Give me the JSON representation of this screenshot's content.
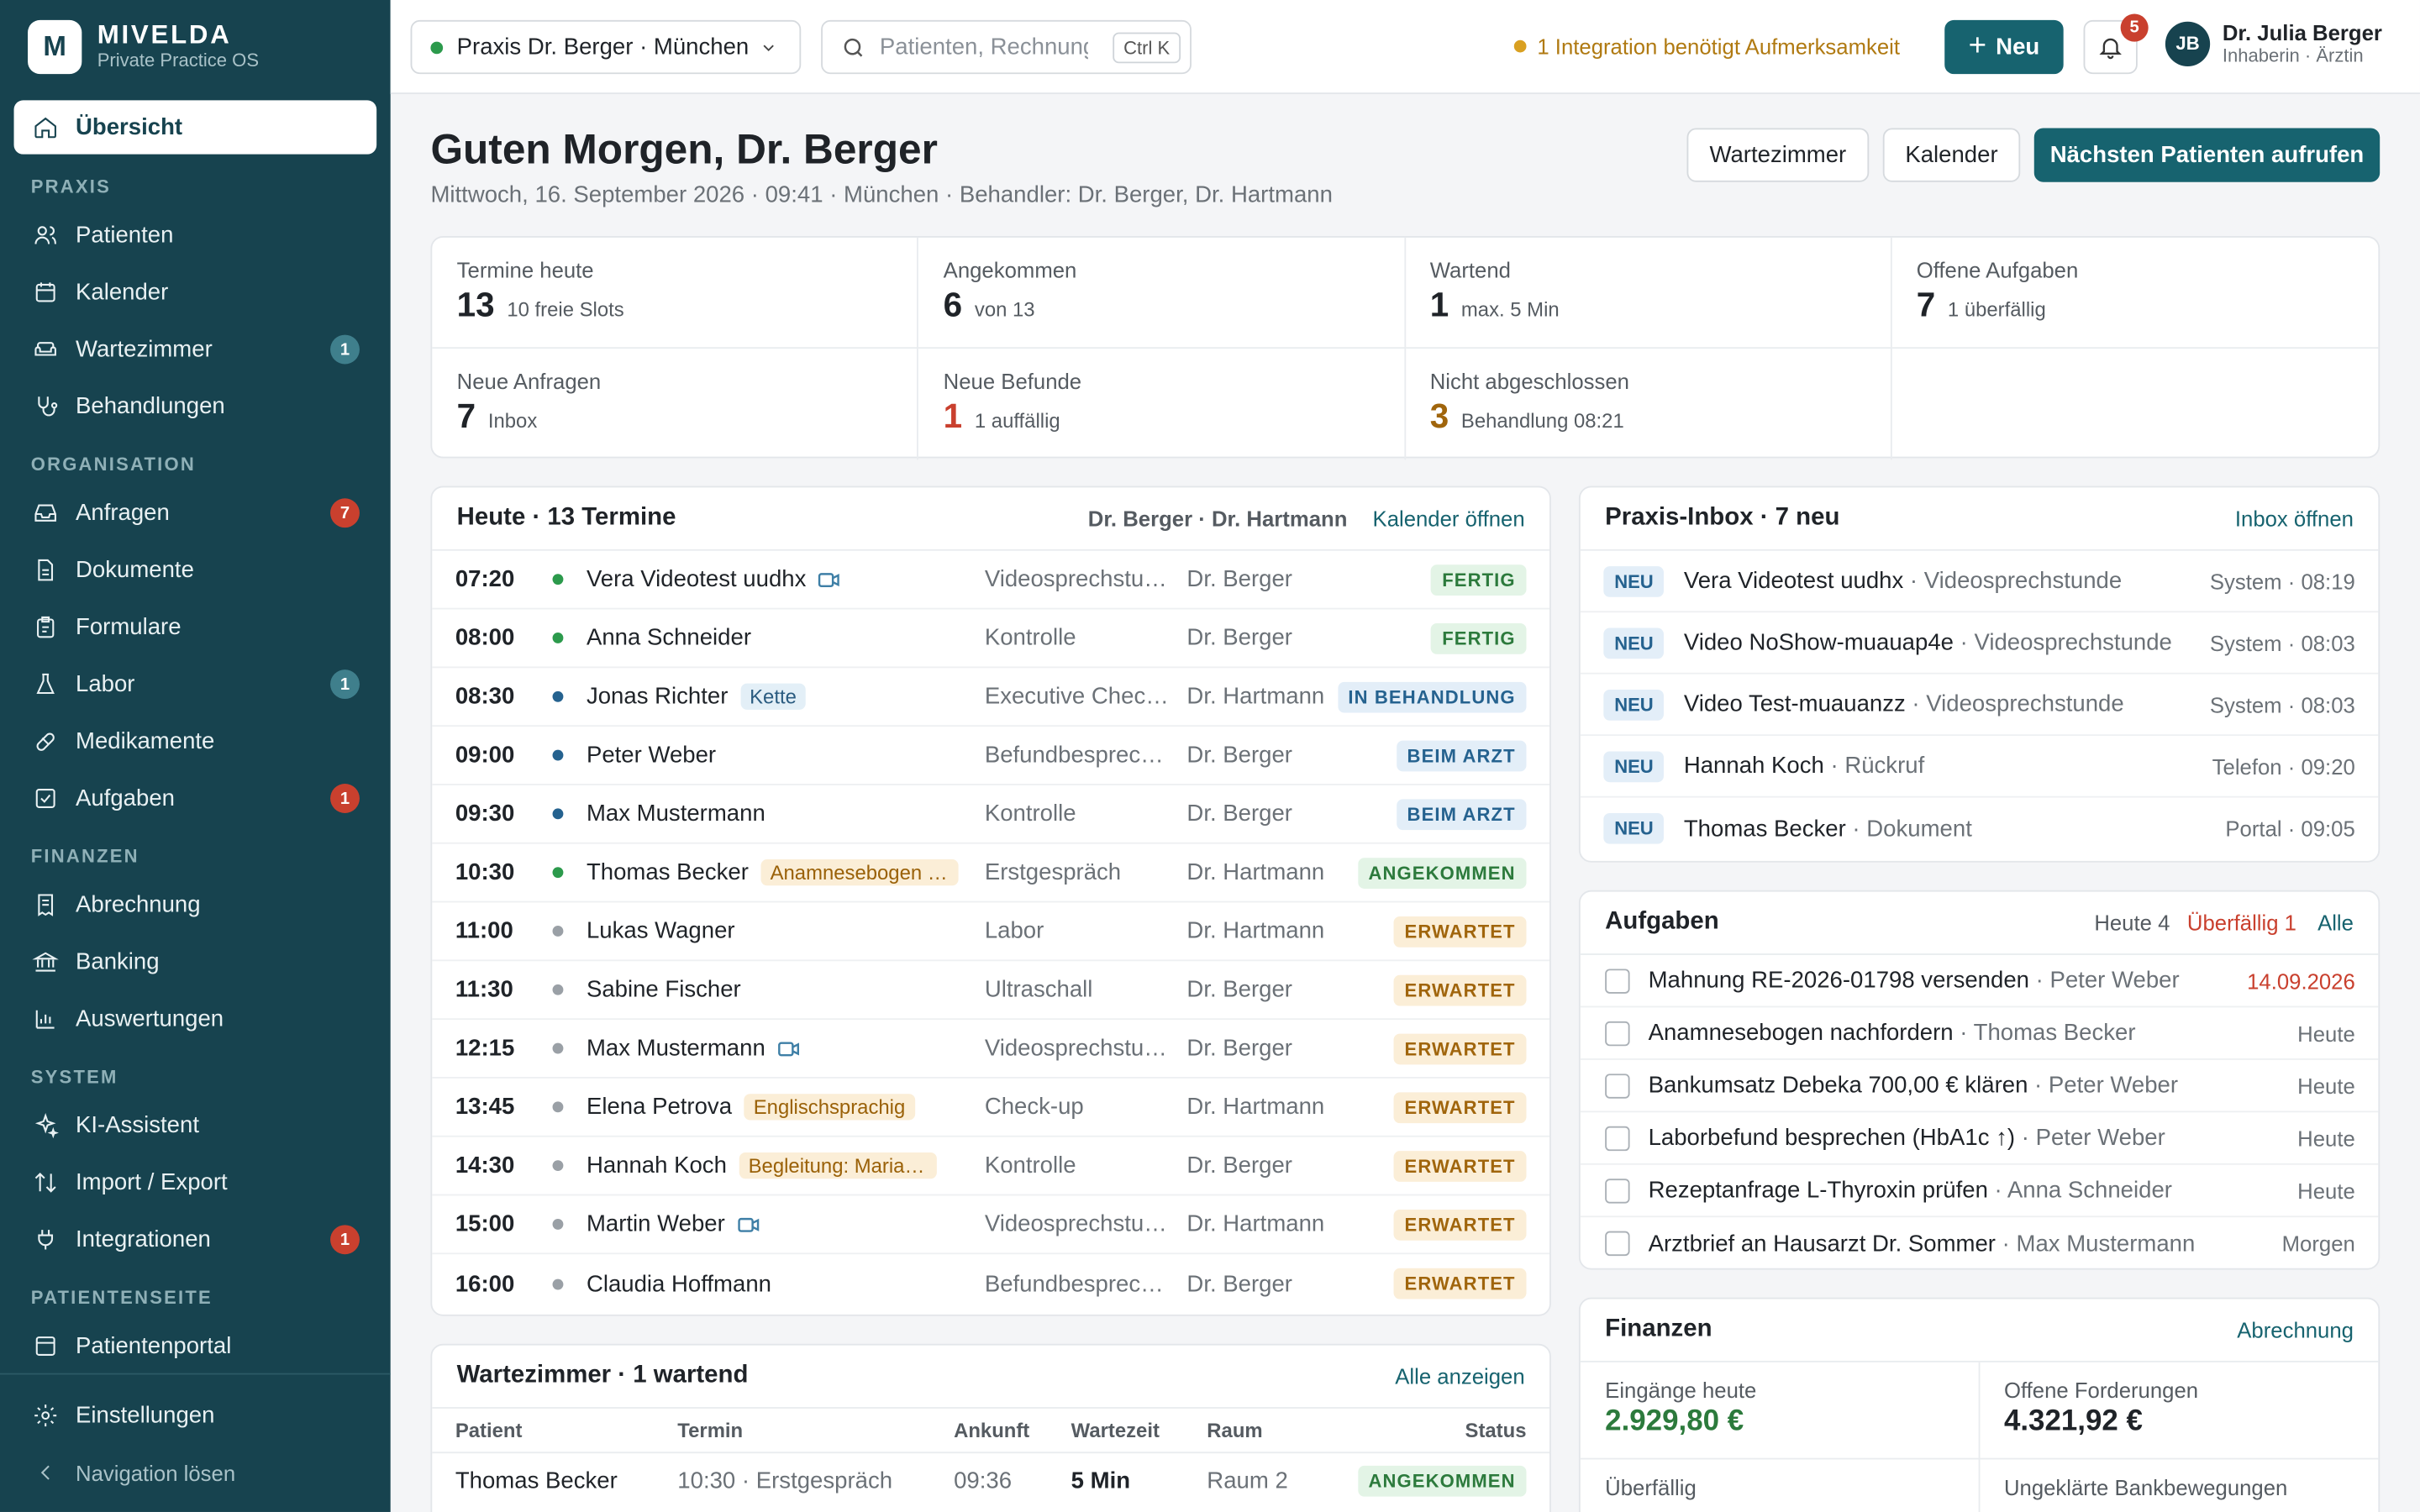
{
  "brand": {
    "logo": "M",
    "name": "MIVELDA",
    "tagline": "Private Practice OS"
  },
  "colors": {
    "primary": "#17636f",
    "sidebar": "#17434f",
    "success": "#2c7a3c",
    "danger": "#c9402e",
    "warning": "#a0650c"
  },
  "sidebar": {
    "active": {
      "label": "Übersicht",
      "icon": "home-icon"
    },
    "sections": [
      {
        "title": "PRAXIS",
        "items": [
          {
            "label": "Patienten",
            "icon": "users-icon",
            "badge": ""
          },
          {
            "label": "Kalender",
            "icon": "calendar-icon",
            "badge": ""
          },
          {
            "label": "Wartezimmer",
            "icon": "sofa-icon",
            "badge": "1"
          },
          {
            "label": "Behandlungen",
            "icon": "stethoscope-icon",
            "badge": ""
          }
        ]
      },
      {
        "title": "ORGANISATION",
        "items": [
          {
            "label": "Anfragen",
            "icon": "inbox-icon",
            "badge": "7"
          },
          {
            "label": "Dokumente",
            "icon": "document-icon",
            "badge": ""
          },
          {
            "label": "Formulare",
            "icon": "clipboard-icon",
            "badge": ""
          },
          {
            "label": "Labor",
            "icon": "flask-icon",
            "badge": "1"
          },
          {
            "label": "Medikamente",
            "icon": "pill-icon",
            "badge": ""
          },
          {
            "label": "Aufgaben",
            "icon": "check-square-icon",
            "badge": "1"
          }
        ]
      },
      {
        "title": "FINANZEN",
        "items": [
          {
            "label": "Abrechnung",
            "icon": "receipt-icon",
            "badge": ""
          },
          {
            "label": "Banking",
            "icon": "bank-icon",
            "badge": ""
          },
          {
            "label": "Auswertungen",
            "icon": "bar-chart-icon",
            "badge": ""
          }
        ]
      },
      {
        "title": "SYSTEM",
        "items": [
          {
            "label": "KI-Assistent",
            "icon": "sparkles-icon",
            "badge": ""
          },
          {
            "label": "Import / Export",
            "icon": "arrows-icon",
            "badge": ""
          },
          {
            "label": "Integrationen",
            "icon": "plug-icon",
            "badge": "1"
          }
        ]
      },
      {
        "title": "PATIENTENSEITE",
        "items": [
          {
            "label": "Patientenportal",
            "icon": "portal-icon",
            "badge": ""
          }
        ]
      }
    ],
    "settings": "Einstellungen",
    "collapse": "Navigation lösen"
  },
  "topbar": {
    "practice": "Praxis Dr. Berger · München",
    "search_placeholder": "Patienten, Rechnungen …",
    "search_shortcut": "Ctrl K",
    "integration_alert": "1 Integration benötigt Aufmerksamkeit",
    "new_label": "Neu",
    "notifications": "5",
    "user": {
      "initials": "JB",
      "name": "Dr. Julia Berger",
      "role": "Inhaberin · Ärztin"
    }
  },
  "header": {
    "greeting": "Guten Morgen, Dr. Berger",
    "subtitle": "Mittwoch, 16. September 2026 · 09:41 · München · Behandler: Dr. Berger, Dr. Hartmann",
    "btn_waiting": "Wartezimmer",
    "btn_calendar": "Kalender",
    "btn_next": "Nächsten Patienten aufrufen"
  },
  "stats": [
    {
      "label": "Termine heute",
      "value": "13",
      "sub": "10 freie Slots",
      "color": "#1f2328"
    },
    {
      "label": "Angekommen",
      "value": "6",
      "sub": "von 13",
      "color": "#1f2328"
    },
    {
      "label": "Wartend",
      "value": "1",
      "sub": "max. 5 Min",
      "color": "#1f2328"
    },
    {
      "label": "Offene Aufgaben",
      "value": "7",
      "sub": "1 überfällig",
      "color": "#1f2328"
    },
    {
      "label": "Neue Anfragen",
      "value": "7",
      "sub": "Inbox",
      "color": "#1f2328"
    },
    {
      "label": "Neue Befunde",
      "value": "1",
      "sub": "1 auffällig",
      "color": "#c9402e"
    },
    {
      "label": "Nicht abgeschlossen",
      "value": "3",
      "sub": "Behandlung 08:21",
      "color": "#a0650c"
    }
  ],
  "today": {
    "title": "Heute · 13 Termine",
    "doctors": "Dr. Berger · Dr. Hartmann",
    "link": "Kalender öffnen",
    "rows": [
      {
        "time": "07:20",
        "dot": "#2c9a4c",
        "name": "Vera Videotest uudhx",
        "video": true,
        "tag": "",
        "tagType": "",
        "type": "Videosprechstunde",
        "doctor": "Dr. Berger",
        "status": "FERTIG",
        "st": "st-fertig"
      },
      {
        "time": "08:00",
        "dot": "#2c9a4c",
        "name": "Anna Schneider",
        "video": false,
        "tag": "",
        "tagType": "",
        "type": "Kontrolle",
        "doctor": "Dr. Berger",
        "status": "FERTIG",
        "st": "st-fertig"
      },
      {
        "time": "08:30",
        "dot": "#25628f",
        "name": "Jonas Richter",
        "video": false,
        "tag": "Kette",
        "tagType": "tag-blue",
        "type": "Executive Check-up",
        "doctor": "Dr. Hartmann",
        "status": "IN BEHANDLUNG",
        "st": "st-behandlung"
      },
      {
        "time": "09:00",
        "dot": "#25628f",
        "name": "Peter Weber",
        "video": false,
        "tag": "",
        "tagType": "",
        "type": "Befundbesprechung",
        "doctor": "Dr. Berger",
        "status": "BEIM ARZT",
        "st": "st-arzt"
      },
      {
        "time": "09:30",
        "dot": "#25628f",
        "name": "Max Mustermann",
        "video": false,
        "tag": "",
        "tagType": "",
        "type": "Kontrolle",
        "doctor": "Dr. Berger",
        "status": "BEIM ARZT",
        "st": "st-arzt"
      },
      {
        "time": "10:30",
        "dot": "#2c9a4c",
        "name": "Thomas Becker",
        "video": false,
        "tag": "Anamnesebogen fehlt",
        "tagType": "tag-orange",
        "type": "Erstgespräch",
        "doctor": "Dr. Hartmann",
        "status": "ANGEKOMMEN",
        "st": "st-angekommen"
      },
      {
        "time": "11:00",
        "dot": "#9aa0a6",
        "name": "Lukas Wagner",
        "video": false,
        "tag": "",
        "tagType": "",
        "type": "Labor",
        "doctor": "Dr. Hartmann",
        "status": "ERWARTET",
        "st": "st-erwartet"
      },
      {
        "time": "11:30",
        "dot": "#9aa0a6",
        "name": "Sabine Fischer",
        "video": false,
        "tag": "",
        "tagType": "",
        "type": "Ultraschall",
        "doctor": "Dr. Berger",
        "status": "ERWARTET",
        "st": "st-erwartet"
      },
      {
        "time": "12:15",
        "dot": "#9aa0a6",
        "name": "Max Mustermann",
        "video": true,
        "tag": "",
        "tagType": "",
        "type": "Videosprechstunde",
        "doctor": "Dr. Berger",
        "status": "ERWARTET",
        "st": "st-erwartet"
      },
      {
        "time": "13:45",
        "dot": "#9aa0a6",
        "name": "Elena Petrova",
        "video": false,
        "tag": "Englischsprachig",
        "tagType": "tag-orange",
        "type": "Check-up",
        "doctor": "Dr. Hartmann",
        "status": "ERWARTET",
        "st": "st-erwartet"
      },
      {
        "time": "14:30",
        "dot": "#9aa0a6",
        "name": "Hannah Koch",
        "video": false,
        "tag": "Begleitung: Maria Koch",
        "tagType": "tag-orange",
        "type": "Kontrolle",
        "doctor": "Dr. Berger",
        "status": "ERWARTET",
        "st": "st-erwartet"
      },
      {
        "time": "15:00",
        "dot": "#9aa0a6",
        "name": "Martin Weber",
        "video": true,
        "tag": "",
        "tagType": "",
        "type": "Videosprechstunde",
        "doctor": "Dr. Hartmann",
        "status": "ERWARTET",
        "st": "st-erwartet"
      },
      {
        "time": "16:00",
        "dot": "#9aa0a6",
        "name": "Claudia Hoffmann",
        "video": false,
        "tag": "",
        "tagType": "",
        "type": "Befundbesprechung",
        "doctor": "Dr. Berger",
        "status": "ERWARTET",
        "st": "st-erwartet"
      }
    ]
  },
  "waiting": {
    "title": "Wartezimmer · 1 wartend",
    "link": "Alle anzeigen",
    "cols": [
      "Patient",
      "Termin",
      "Ankunft",
      "Wartezeit",
      "Raum",
      "Status"
    ],
    "rows": [
      {
        "patient": "Thomas Becker",
        "termin": "10:30 · Erstgespräch",
        "ankunft": "09:36",
        "wartezeit": "5 Min",
        "raum": "Raum 2",
        "status": "ANGEKOMMEN"
      }
    ]
  },
  "inbox": {
    "title": "Praxis-Inbox · 7 neu",
    "link": "Inbox öffnen",
    "badge": "NEU",
    "rows": [
      {
        "name": "Vera Videotest uudhx",
        "kind": "Videosprechstunde",
        "meta": "System · 08:19"
      },
      {
        "name": "Video NoShow-muauap4e",
        "kind": "Videosprechstunde",
        "meta": "System · 08:03"
      },
      {
        "name": "Video Test-muauanzz",
        "kind": "Videosprechstunde",
        "meta": "System · 08:03"
      },
      {
        "name": "Hannah Koch",
        "kind": "Rückruf",
        "meta": "Telefon · 09:20"
      },
      {
        "name": "Thomas Becker",
        "kind": "Dokument",
        "meta": "Portal · 09:05"
      }
    ]
  },
  "tasks": {
    "title": "Aufgaben",
    "today": "Heute 4",
    "overdue": "Überfällig 1",
    "all": "Alle",
    "rows": [
      {
        "text": "Mahnung RE-2026-01798 versenden",
        "who": "Peter Weber",
        "due": "14.09.2026",
        "overdue": true
      },
      {
        "text": "Anamnesebogen nachfordern",
        "who": "Thomas Becker",
        "due": "Heute",
        "overdue": false
      },
      {
        "text": "Bankumsatz Debeka 700,00 € klären",
        "who": "Peter Weber",
        "due": "Heute",
        "overdue": false
      },
      {
        "text": "Laborbefund besprechen (HbA1c ↑)",
        "who": "Peter Weber",
        "due": "Heute",
        "overdue": false
      },
      {
        "text": "Rezeptanfrage L-Thyroxin prüfen",
        "who": "Anna Schneider",
        "due": "Heute",
        "overdue": false
      },
      {
        "text": "Arztbrief an Hausarzt Dr. Sommer",
        "who": "Max Mustermann",
        "due": "Morgen",
        "overdue": false
      }
    ]
  },
  "finance": {
    "title": "Finanzen",
    "link": "Abrechnung",
    "cells": [
      {
        "label": "Eingänge heute",
        "value": "2.929,80 €",
        "color": "#2c7a3c"
      },
      {
        "label": "Offene Forderungen",
        "value": "4.321,92 €",
        "color": "#1f2328"
      },
      {
        "label": "Überfällig",
        "value": "",
        "color": "#c9402e"
      },
      {
        "label": "Ungeklärte Bankbewegungen",
        "value": "",
        "color": "#1f2328"
      }
    ]
  }
}
